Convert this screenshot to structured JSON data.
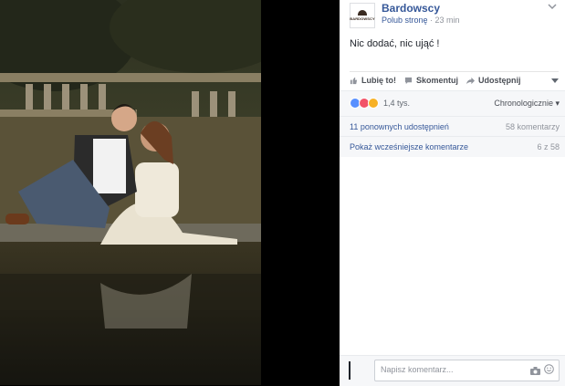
{
  "photo": {
    "subject": "couple-on-dock-photo"
  },
  "post": {
    "page_name": "Bardowscy",
    "avatar_text": "BARDOWSCY",
    "follow_label": "Polub stronę",
    "separator": " · ",
    "time": "23 min",
    "text": "Nic dodać, nic ująć !"
  },
  "actions": {
    "like": "Lubię to!",
    "comment": "Skomentuj",
    "share": "Udostępnij"
  },
  "reactions": {
    "types": [
      "like",
      "love",
      "wow"
    ],
    "count": "1,4 tys.",
    "sort_label": "Chronologicznie"
  },
  "shares": {
    "text": "11 ponownych udostępnień",
    "comments_count": "58 komentarzy"
  },
  "earlier": {
    "text": "Pokaż wcześniejsze komentarze",
    "pagination": "6 z 58"
  },
  "composer": {
    "placeholder": "Napisz komentarz..."
  },
  "colors": {
    "link": "#365899",
    "muted": "#90949c",
    "like": "#5890ff",
    "love": "#f25268",
    "wow": "#f7b125"
  }
}
